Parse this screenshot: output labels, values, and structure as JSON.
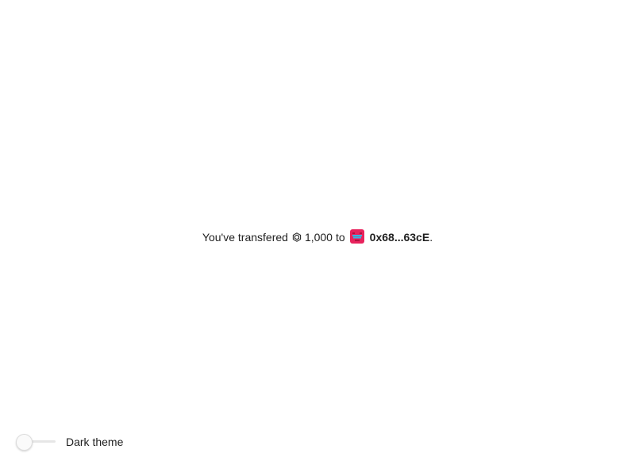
{
  "transfer": {
    "prefix": "You've transfered",
    "token_icon": "token-hexagon-icon",
    "amount": "1,000",
    "connector": "to",
    "avatar_icon": "identicon-avatar",
    "address": "0x68...63cE",
    "suffix": "."
  },
  "theme_toggle": {
    "label": "Dark theme",
    "enabled": false
  },
  "colors": {
    "avatar_primary": "#e8235d",
    "avatar_secondary": "#35b6e4"
  }
}
